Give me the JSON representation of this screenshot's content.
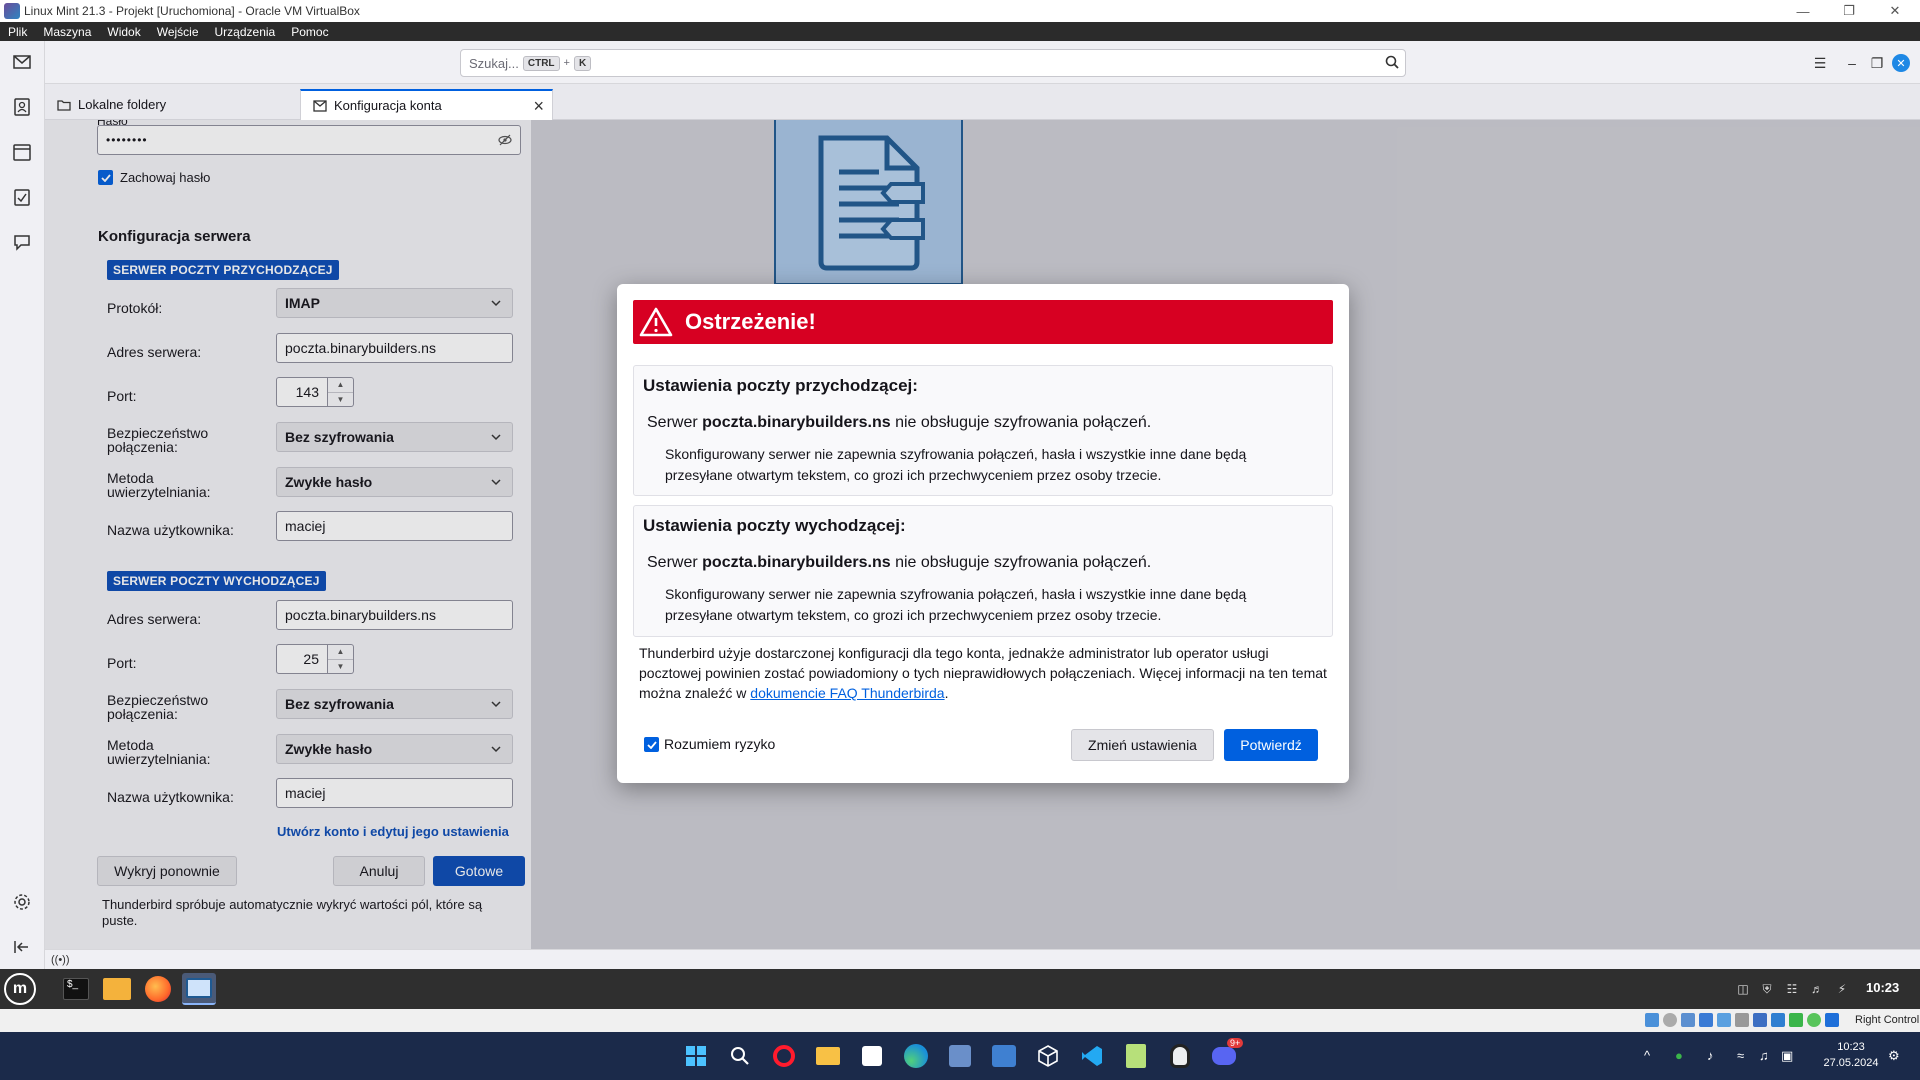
{
  "host": {
    "title": "Linux Mint 21.3 - Projekt [Uruchomiona] - Oracle VM VirtualBox",
    "menu": [
      "Plik",
      "Maszyna",
      "Widok",
      "Wejście",
      "Urządzenia",
      "Pomoc"
    ],
    "status_right": "Right Control"
  },
  "thunderbird": {
    "search": {
      "placeholder": "Szukaj...",
      "key1": "CTRL",
      "plus": "+",
      "key2": "K"
    },
    "tabs": [
      {
        "label": "Lokalne foldery"
      },
      {
        "label": "Konfiguracja konta"
      }
    ],
    "form": {
      "password_label": "Hasło",
      "password_value": "••••••••",
      "remember_password": "Zachowaj hasło",
      "server_config_title": "Konfiguracja serwera",
      "incoming_badge": "SERWER POCZTY PRZYCHODZĄCEJ",
      "outgoing_badge": "SERWER POCZTY WYCHODZĄCEJ",
      "incoming": {
        "protocol_label": "Protokół:",
        "protocol_value": "IMAP",
        "server_label": "Adres serwera:",
        "server_value": "poczta.binarybuilders.ns",
        "port_label": "Port:",
        "port_value": "143",
        "security_label_1": "Bezpieczeństwo",
        "security_label_2": "połączenia:",
        "security_value": "Bez szyfrowania",
        "auth_label_1": "Metoda",
        "auth_label_2": "uwierzytelniania:",
        "auth_value": "Zwykłe hasło",
        "user_label": "Nazwa użytkownika:",
        "user_value": "maciej"
      },
      "outgoing": {
        "server_label": "Adres serwera:",
        "server_value": "poczta.binarybuilders.ns",
        "port_label": "Port:",
        "port_value": "25",
        "security_label_1": "Bezpieczeństwo",
        "security_label_2": "połączenia:",
        "security_value": "Bez szyfrowania",
        "auth_label_1": "Metoda",
        "auth_label_2": "uwierzytelniania:",
        "auth_value": "Zwykłe hasło",
        "user_label": "Nazwa użytkownika:",
        "user_value": "maciej"
      },
      "create_link": "Utwórz konto i edytuj jego ustawienia",
      "buttons": {
        "redetect": "Wykryj ponownie",
        "cancel": "Anuluj",
        "done": "Gotowe"
      },
      "footer_note": "Thunderbird spróbuje automatycznie wykryć wartości pól, które są puste."
    },
    "dialog": {
      "title": "Ostrzeżenie!",
      "incoming": {
        "heading": "Ustawienia poczty przychodzącej:",
        "line_prefix": "Serwer",
        "server": "poczta.binarybuilders.ns",
        "line_suffix": "nie obsługuje szyfrowania połączeń.",
        "detail": "Skonfigurowany serwer nie zapewnia szyfrowania połączeń, hasła i wszystkie inne dane będą przesyłane otwartym tekstem, co grozi ich przechwyceniem przez osoby trzecie."
      },
      "outgoing": {
        "heading": "Ustawienia poczty wychodzącej:",
        "line_prefix": "Serwer",
        "server": "poczta.binarybuilders.ns",
        "line_suffix": "nie obsługuje szyfrowania połączeń.",
        "detail": "Skonfigurowany serwer nie zapewnia szyfrowania połączeń, hasła i wszystkie inne dane będą przesyłane otwartym tekstem, co grozi ich przechwyceniem przez osoby trzecie."
      },
      "info_text": "Thunderbird użyje dostarczonej konfiguracji dla tego konta, jednakże administrator lub operator usługi pocztowej powinien zostać powiadomiony o tych nieprawidłowych połączeniach. Więcej informacji na ten temat można znaleźć w",
      "info_link": "dokumencie FAQ Thunderbirda",
      "info_end": ".",
      "understand_risk": "Rozumiem ryzyko",
      "btn_change": "Zmień ustawienia",
      "btn_confirm": "Potwierdź"
    }
  },
  "mint": {
    "clock": "10:23"
  },
  "windows": {
    "time": "10:23",
    "date": "27.05.2024",
    "discord_badge": "9+"
  },
  "colors": {
    "accent": "#0060df",
    "warning": "#d70022",
    "badge": "#0b4cb5"
  }
}
